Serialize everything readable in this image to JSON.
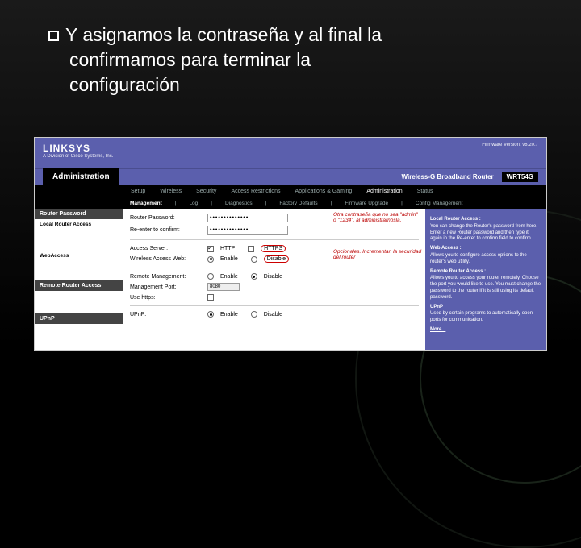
{
  "slide": {
    "bullet_text_1": "Y asignamos la contraseña y al final la",
    "bullet_text_2": "confirmamos para terminar la",
    "bullet_text_3": "configuración"
  },
  "router": {
    "logo": "LINKSYS",
    "logo_sub": "A Division of Cisco Systems, Inc.",
    "firmware": "Firmware Version: v8.20.7",
    "product": "Wireless-G Broadband Router",
    "model": "WRT54G",
    "section": "Administration",
    "tabs": [
      "Setup",
      "Wireless",
      "Security",
      "Access Restrictions",
      "Applications & Gaming",
      "Administration",
      "Status"
    ],
    "subtabs": [
      "Management",
      "Log",
      "Diagnostics",
      "Factory Defaults",
      "Firmware Upgrade",
      "Config Management"
    ],
    "left": {
      "router_password": "Router Password",
      "local_access": "Local Router Access",
      "web_access": "WebAccess",
      "remote_access": "Remote Router Access",
      "upnp": "UPnP"
    },
    "fields": {
      "router_password_label": "Router Password:",
      "reenter_label": "Re-enter to confirm:",
      "password_mask": "••••••••••••••",
      "note_top": "Otra contraseña que no sea \"admin\" o \"1234\", al administrarnósla.",
      "access_server_label": "Access Server:",
      "http": "HTTP",
      "https": "HTTPS",
      "wireless_access_label": "Wireless Access Web:",
      "enable": "Enable",
      "disable": "Disable",
      "note_mid": "Opcionales. Incrementan la securidad del router",
      "remote_mgmt_label": "Remote Management:",
      "mgmt_port_label": "Management Port:",
      "mgmt_port_value": "8080",
      "use_https_label": "Use https:",
      "upnp_label": "UPnP:"
    },
    "help": {
      "h1": "Local Router Access :",
      "t1": "You can change the Router's password from here. Enter a new Router password and then type it again in the Re-enter to confirm field to confirm.",
      "h2": "Web Access :",
      "t2": "Allows you to configure access options to the router's web utility.",
      "h3": "Remote Router Access :",
      "t3": "Allows you to access your router remotely. Choose the port you would like to use. You must change the password to the router if it is still using its default password.",
      "h4": "UPnP :",
      "t4": "Used by certain programs to automatically open ports for communication.",
      "more": "More..."
    }
  }
}
